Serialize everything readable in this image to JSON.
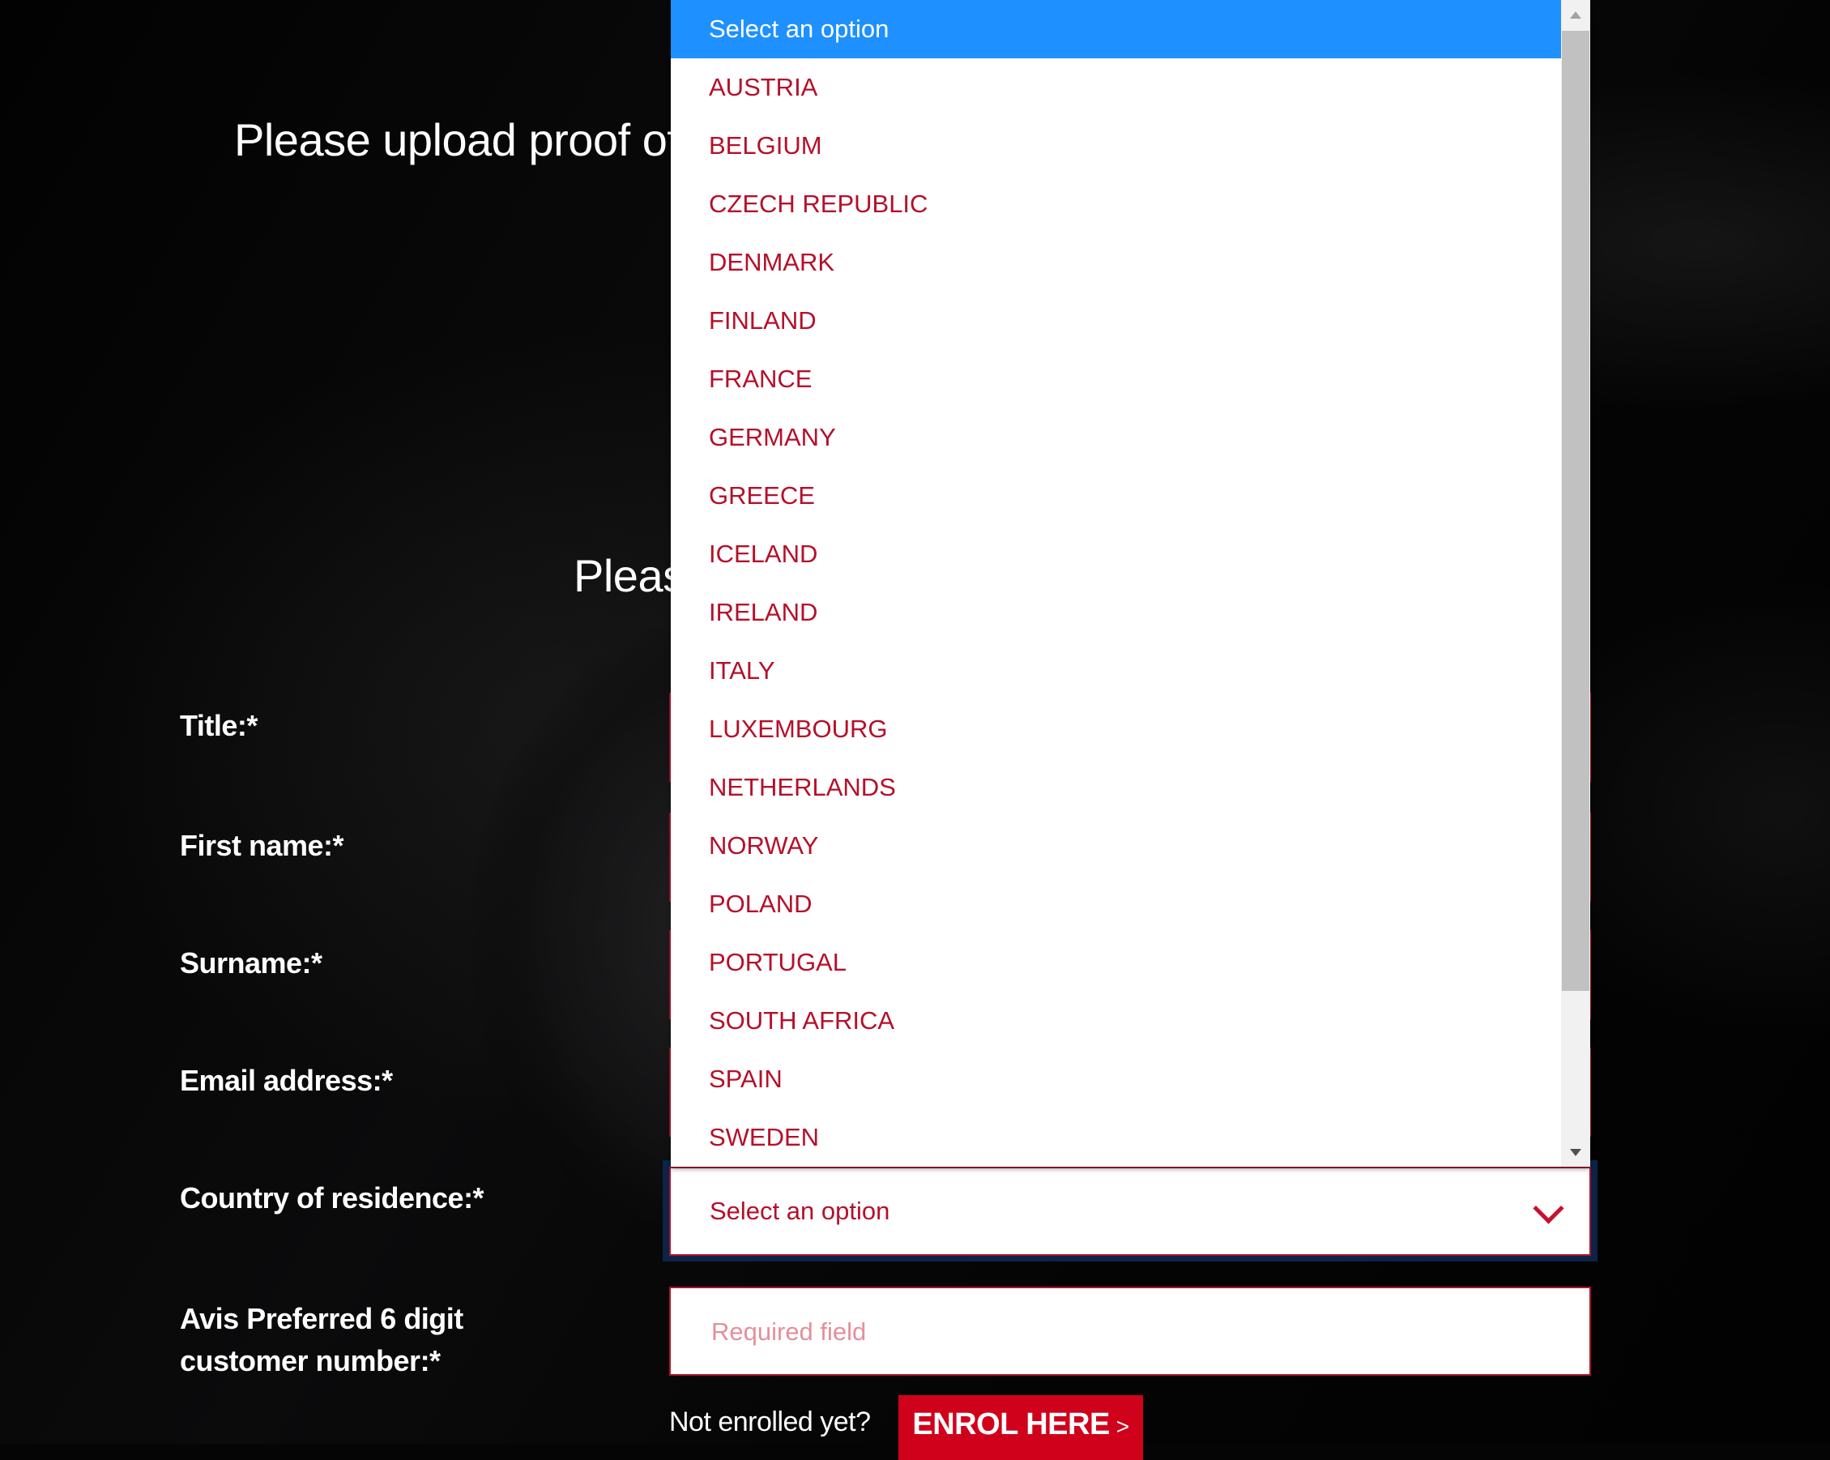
{
  "headings": {
    "upload_proof": "Please upload proof of",
    "second_heading_visible": "Pleas"
  },
  "form": {
    "labels": {
      "title": "Title:*",
      "first_name": "First name:*",
      "surname": "Surname:*",
      "email": "Email address:*",
      "country": "Country of residence:*",
      "customer_number_line1": "Avis Preferred 6 digit",
      "customer_number_line2": "customer number:*"
    },
    "country_select": {
      "value": "Select an option",
      "icon": "chevron-down-icon"
    },
    "customer_number_input": {
      "placeholder": "Required field",
      "value": ""
    }
  },
  "dropdown": {
    "selected": "Select an option",
    "options": [
      "Select an option",
      "AUSTRIA",
      "BELGIUM",
      "CZECH REPUBLIC",
      "DENMARK",
      "FINLAND",
      "FRANCE",
      "GERMANY",
      "GREECE",
      "ICELAND",
      "IRELAND",
      "ITALY",
      "LUXEMBOURG",
      "NETHERLANDS",
      "NORWAY",
      "POLAND",
      "PORTUGAL",
      "SOUTH AFRICA",
      "SPAIN",
      "SWEDEN"
    ]
  },
  "enrol": {
    "prompt": "Not enrolled yet?",
    "button_label": "ENROL HERE",
    "button_arrow": ">"
  },
  "colors": {
    "brand_red": "#d0021b",
    "option_text": "#b5102a",
    "highlight_blue": "#1e90ff",
    "focus_ring": "#0b2447",
    "placeholder": "#e3909b"
  }
}
